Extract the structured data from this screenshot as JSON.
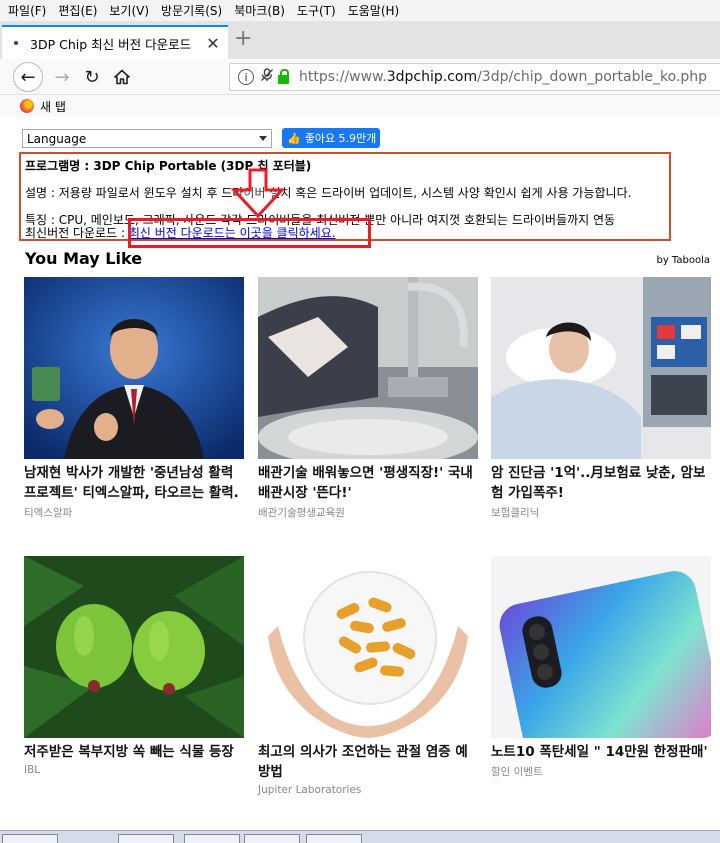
{
  "menu": [
    "파일(F)",
    "편집(E)",
    "보기(V)",
    "방문기록(S)",
    "북마크(B)",
    "도구(T)",
    "도움말(H)"
  ],
  "tab": {
    "title": "3DP Chip 최신 버전 다운로드",
    "close": "✕",
    "new_tab": "+"
  },
  "nav": {
    "back": "←",
    "forward": "→",
    "reload": "↻",
    "home": "⌂",
    "url_prefix": "https://www.",
    "url_domain": "3dpchip.com",
    "url_path": "/3dp/chip_down_portable_ko.php"
  },
  "bookmarks": {
    "item": "새 탭"
  },
  "page": {
    "language_select": "Language",
    "fb_like": "좋아요 5.9만개",
    "program_line": "프로그램명 : 3DP Chip Portable (3DP 칩 포터블)",
    "desc_line": "설명 : 저용량 파일로서 윈도우 설치 후 드라이버 설치 혹은 드라이버 업데이트, 시스템 사양 확인시 쉽게 사용 가능합니다.",
    "feature_line": "특징 : CPU, 메인보드, 그래픽, 사운드 각각 드라이버들을 최신버전 뿐만 아니라 여지껏 호환되는 드라이버들까지 연동",
    "download_prefix": "최신버전 다운로드 : ",
    "download_link": "최신 버전 다운로드는 이곳을 클릭하세요.",
    "you_may_like": "You May Like",
    "by_taboola": "by Taboola"
  },
  "cards": [
    {
      "headline": "남재현 박사가 개발한 '중년남성 활력 프로젝트' 티엑스알파, 타오르는 활력.",
      "source": "티엑스알파"
    },
    {
      "headline": "배관기술 배워놓으면 '평생직장!' 국내 배관시장 '뜬다!'",
      "source": "배관기술평생교육원"
    },
    {
      "headline": "암 진단금 '1억'..月보험료 낮춘, 암보험 가입폭주!",
      "source": "보험클리닉"
    },
    {
      "headline": "저주받은 복부지방 쏙 빼는 식물 등장",
      "source": "IBL"
    },
    {
      "headline": "최고의 의사가 조언하는 관절 염증 예방법",
      "source": "Jupiter Laboratories"
    },
    {
      "headline": "노트10 폭탄세일 \" 14만원 한정판매'",
      "source": "할인 이벤트"
    }
  ],
  "colors": {
    "accent_tab": "#0a84ff",
    "infobox_border": "#c5522a",
    "highlight_red": "#ea1c24",
    "link": "#0000ee",
    "fb_blue": "#1877f2"
  }
}
